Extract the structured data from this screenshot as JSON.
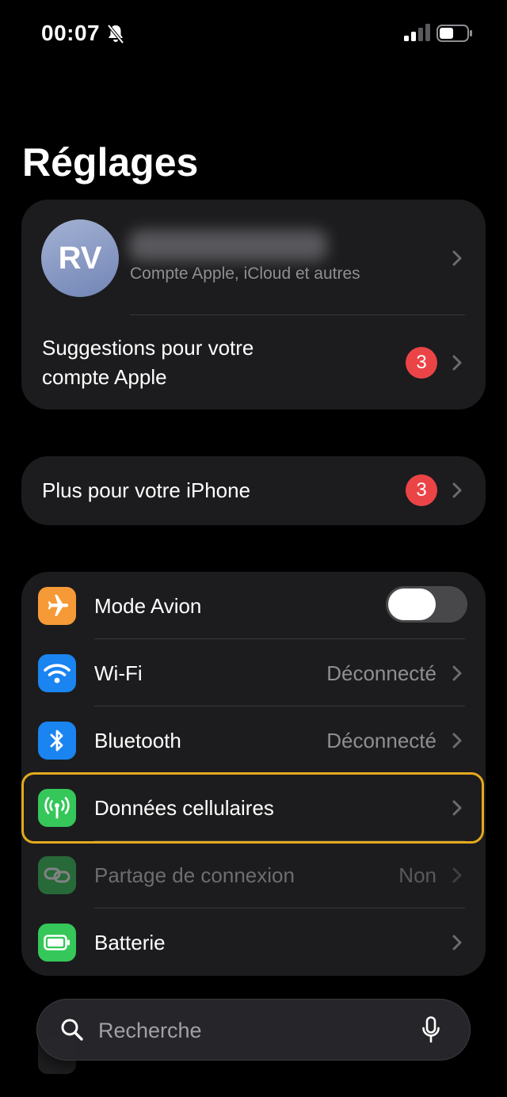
{
  "status_bar": {
    "time": "00:07"
  },
  "page": {
    "title": "Réglages"
  },
  "account": {
    "initials": "RV",
    "subtitle": "Compte Apple, iCloud et autres",
    "suggestions_label": "Suggestions pour votre compte Apple",
    "suggestions_badge": "3"
  },
  "more": {
    "label": "Plus pour votre iPhone",
    "badge": "3"
  },
  "settings": [
    {
      "label": "Mode Avion",
      "value": "",
      "icon": "airplane-icon",
      "color": "#f59a36",
      "toggle": false
    },
    {
      "label": "Wi-Fi",
      "value": "Déconnecté",
      "icon": "wifi-icon",
      "color": "#1a84f0"
    },
    {
      "label": "Bluetooth",
      "value": "Déconnecté",
      "icon": "bluetooth-icon",
      "color": "#1a84f0"
    },
    {
      "label": "Données cellulaires",
      "value": "",
      "icon": "antenna-icon",
      "color": "#35c759",
      "highlighted": true
    },
    {
      "label": "Partage de connexion",
      "value": "Non",
      "icon": "link-icon",
      "color": "#35c759",
      "disabled": true
    },
    {
      "label": "Batterie",
      "value": "",
      "icon": "battery-icon",
      "color": "#35c759"
    }
  ],
  "search": {
    "placeholder": "Recherche"
  },
  "colors": {
    "background": "#000000",
    "card": "#1c1c1e",
    "badge": "#eb4447",
    "highlight": "#e5a91d"
  }
}
